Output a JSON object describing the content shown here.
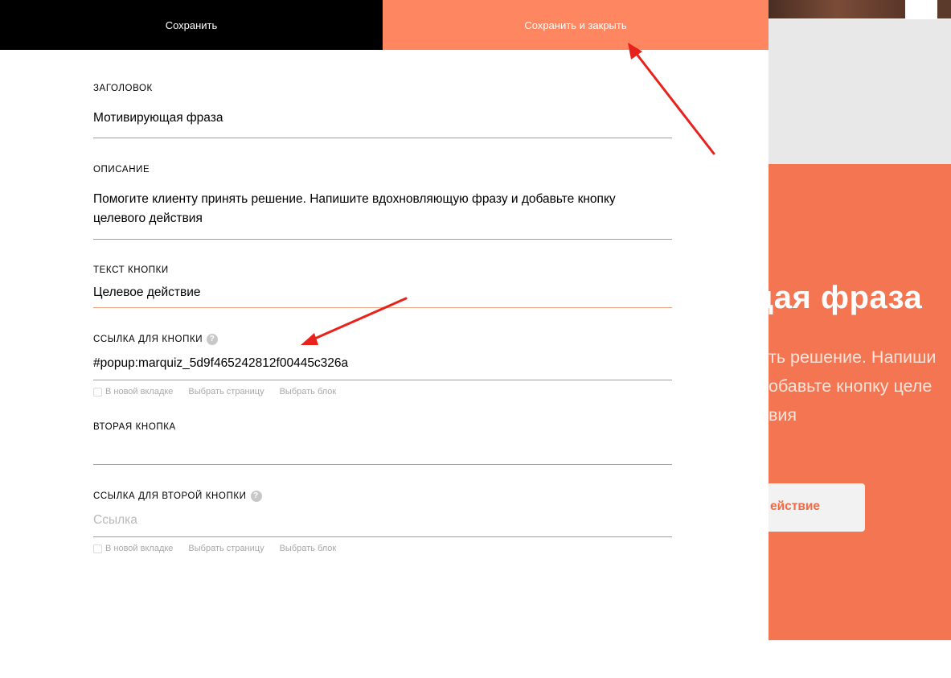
{
  "toolbar": {
    "save_label": "Сохранить",
    "save_close_label": "Сохранить и закрыть"
  },
  "form": {
    "title": {
      "label": "ЗАГОЛОВОК",
      "value": "Мотивирующая фраза"
    },
    "description": {
      "label": "ОПИСАНИЕ",
      "line1": "Помогите клиенту принять решение. Напишите вдохновляющую фразу и добавьте кнопку",
      "line2": "целевого действия"
    },
    "button_text": {
      "label": "ТЕКСТ КНОПКИ",
      "value": "Целевое действие"
    },
    "button_link": {
      "label": "ССЫЛКА ДЛЯ КНОПКИ",
      "help": "?",
      "value": "#popup:marquiz_5d9f465242812f00445c326a",
      "opt_new_tab": "В новой вкладке",
      "opt_page": "Выбрать страницу",
      "opt_block": "Выбрать блок"
    },
    "second_button": {
      "label": "ВТОРАЯ КНОПКА",
      "value": ""
    },
    "second_link": {
      "label": "ССЫЛКА ДЛЯ ВТОРОЙ КНОПКИ",
      "help": "?",
      "placeholder": "Ссылка",
      "opt_new_tab": "В новой вкладке",
      "opt_page": "Выбрать страницу",
      "opt_block": "Выбрать блок"
    }
  },
  "preview": {
    "title": "щая фраза",
    "desc": "ть решение. Напиши\nобавьте кнопку целе\nвия",
    "button": "ействие"
  },
  "colors": {
    "save_bg": "#000000",
    "save_close_bg": "#fe8660",
    "preview_block": "#f47551",
    "arrow": "#e8221b"
  }
}
